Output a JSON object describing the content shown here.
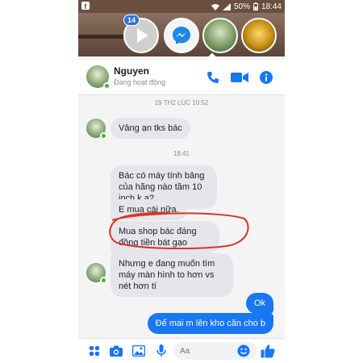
{
  "status_bar": {
    "battery": "50%",
    "time": "18:44"
  },
  "chat_heads": {
    "badge_count": "14"
  },
  "header": {
    "name": "Nguyen",
    "status": "Đang hoạt động"
  },
  "messages": {
    "timestamp_1": "19 TH2 LÚC 10:52",
    "incoming_1": "Vâng ạn tks bác",
    "timestamp_2": "18:41",
    "incoming_2": "Bác có máy tính bảng của hãng nào tầm 10 inch k ạ?",
    "incoming_3": "E mua cái nữa.",
    "incoming_4": "Mua shop bác đáng đồng tiền bát gạo",
    "incoming_5": "Nhưng e đang muốn tìm máy màn hình to hơn vs nét hơn tí",
    "outgoing_1": "Ok",
    "outgoing_2": "Để mai m lên kho căn cho b"
  },
  "composer": {
    "placeholder": "Aa"
  },
  "colors": {
    "accent": "#1877f2",
    "incoming_bubble": "#e4e6eb",
    "highlight_circle": "#d9342b"
  },
  "icons": [
    "play-icon",
    "messenger-icon",
    "phone-icon",
    "video-camera-icon",
    "info-icon",
    "apps-icon",
    "camera-icon",
    "gallery-icon",
    "microphone-icon",
    "emoji-icon",
    "thumbs-up-icon"
  ]
}
